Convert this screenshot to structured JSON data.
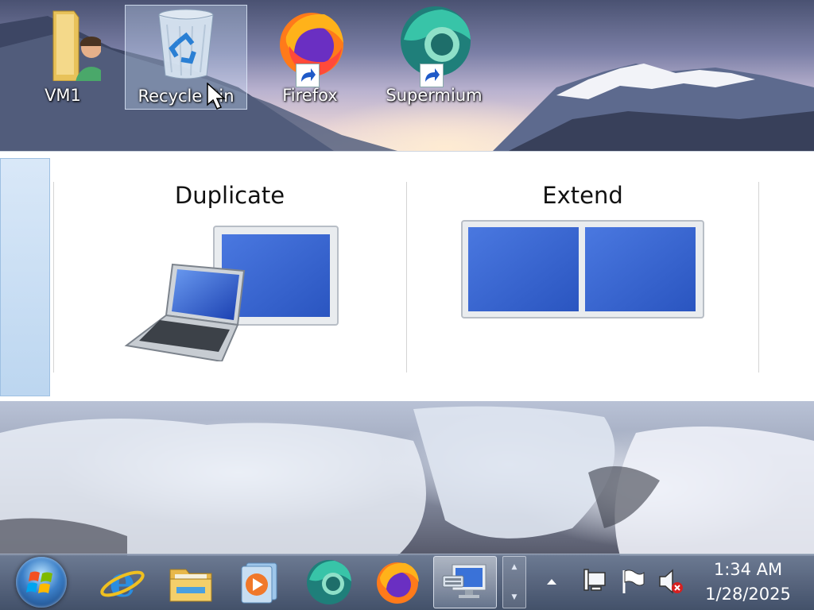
{
  "desktop": {
    "icons": [
      {
        "label": "VM1",
        "icon": "user-folder-icon"
      },
      {
        "label": "Recycle Bin",
        "icon": "recycle-bin-icon",
        "selected": true
      },
      {
        "label": "Firefox",
        "icon": "firefox-icon",
        "shortcut": true
      },
      {
        "label": "Supermium",
        "icon": "supermium-icon",
        "shortcut": true
      }
    ]
  },
  "project_panel": {
    "options": [
      {
        "title": "Duplicate",
        "icon": "duplicate-display-icon"
      },
      {
        "title": "Extend",
        "icon": "extend-display-icon"
      }
    ]
  },
  "taskbar": {
    "pinned": [
      {
        "name": "Internet Explorer",
        "icon": "internet-explorer-icon"
      },
      {
        "name": "Windows Explorer",
        "icon": "file-explorer-icon"
      },
      {
        "name": "Windows Media Player",
        "icon": "media-player-icon"
      },
      {
        "name": "Supermium",
        "icon": "supermium-icon"
      },
      {
        "name": "Firefox",
        "icon": "firefox-icon"
      },
      {
        "name": "Display Projection",
        "icon": "projector-display-icon",
        "active": true
      }
    ],
    "tray": {
      "icons": [
        "show-hidden-icons-arrow",
        "network-icon",
        "action-center-flag-icon",
        "volume-muted-icon"
      ]
    },
    "clock": {
      "time": "1:34 AM",
      "date": "1/28/2025"
    }
  },
  "colors": {
    "display_blue": "#2f5fd0",
    "selection": "#c8dcf5",
    "taskbar": "#4b5a73"
  }
}
